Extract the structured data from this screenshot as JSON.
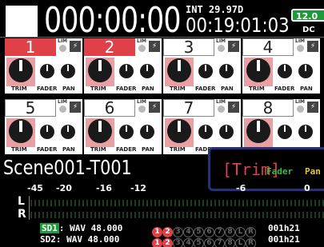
{
  "header": {
    "timecode": "000:00:00",
    "int_label": "INT 29.97D",
    "sub_timecode": "00:19:01:03",
    "battery": "12.0",
    "power": "DC"
  },
  "channels": [
    {
      "num": "1",
      "selected": true
    },
    {
      "num": "2",
      "selected": true
    },
    {
      "num": "3",
      "selected": false
    },
    {
      "num": "4",
      "selected": false
    },
    {
      "num": "5",
      "selected": false
    },
    {
      "num": "6",
      "selected": false
    },
    {
      "num": "7",
      "selected": false
    },
    {
      "num": "8",
      "selected": false
    }
  ],
  "labels": {
    "lim": "LIM",
    "trim": "TRIM",
    "fader": "FADER",
    "pan": "PAN"
  },
  "scene": "Scene001-T001",
  "params": {
    "trim": "[Trim]",
    "fader": "Fader",
    "pan": "Pan"
  },
  "meter": {
    "scale": [
      "-45",
      "-20",
      "-16",
      "-12",
      "-6",
      "0"
    ],
    "l": "L",
    "r": "R"
  },
  "sd": [
    {
      "tag": "SD1",
      "format": ": WAV 48.000",
      "file": "001h21"
    },
    {
      "tag": "SD2",
      "format": ": WAV 48.000",
      "file": "001h21"
    }
  ],
  "tracks": [
    "1",
    "2",
    "3",
    "4",
    "5",
    "6",
    "7",
    "8",
    "L",
    "R"
  ]
}
